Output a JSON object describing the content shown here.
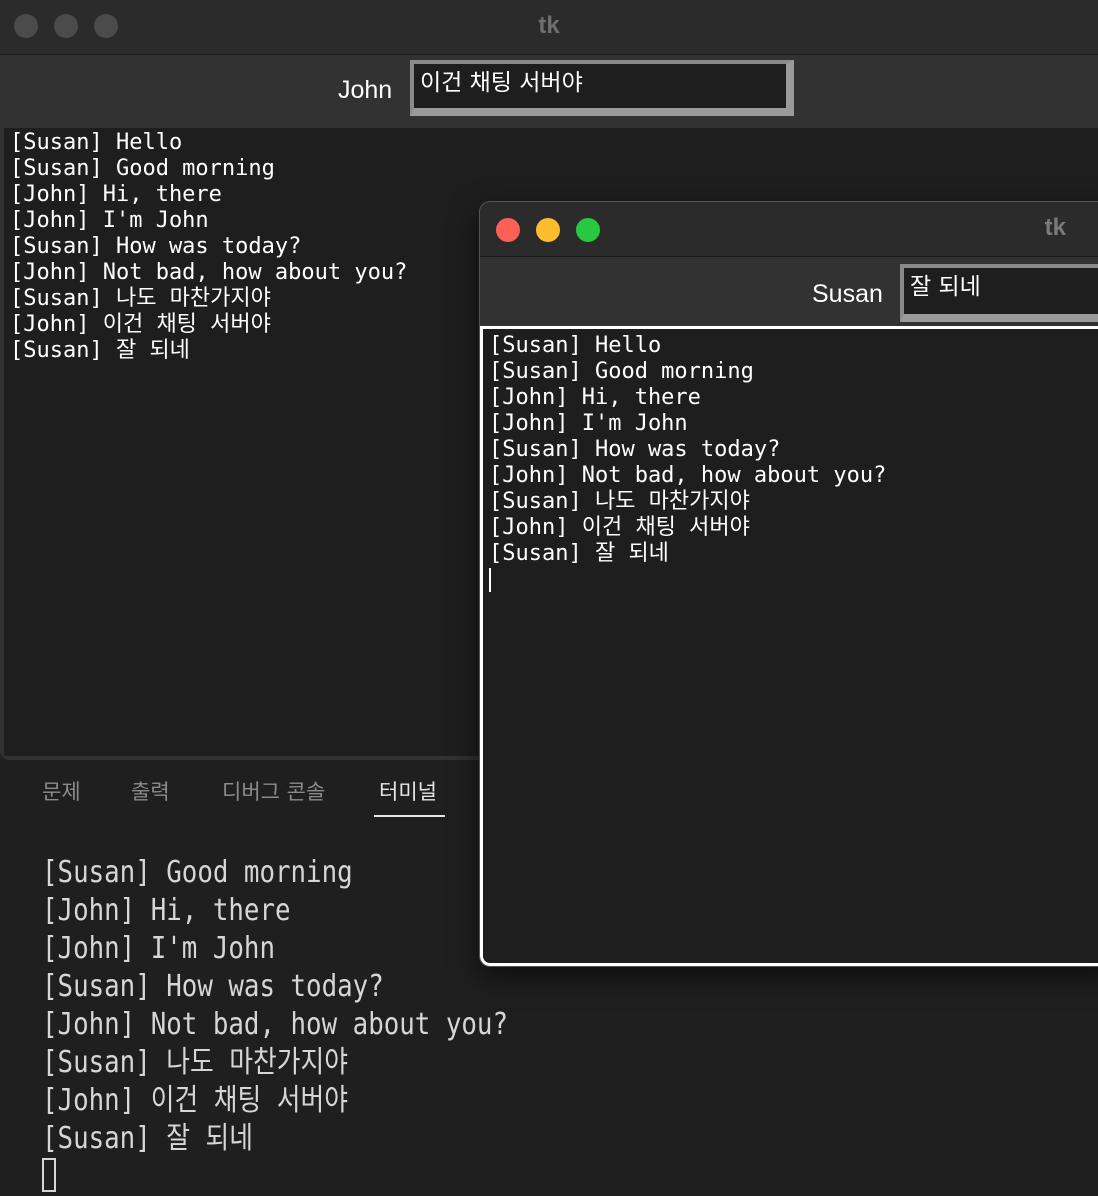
{
  "window_john": {
    "title": "tk",
    "user_label": "John",
    "message_input_value": "이건 채팅 서버야",
    "chat_lines": [
      "[Susan] Hello",
      "[Susan] Good morning",
      "[John] Hi, there",
      "[John] I'm John",
      "[Susan] How was today?",
      "[John] Not bad, how about you?",
      "[Susan] 나도 마찬가지야",
      "[John] 이건 채팅 서버야",
      "[Susan] 잘 되네"
    ]
  },
  "window_susan": {
    "title": "tk",
    "user_label": "Susan",
    "message_input_value": "잘 되네",
    "chat_lines": [
      "[Susan] Hello",
      "[Susan] Good morning",
      "[John] Hi, there",
      "[John] I'm John",
      "[Susan] How was today?",
      "[John] Not bad, how about you?",
      "[Susan] 나도 마찬가지야",
      "[John] 이건 채팅 서버야",
      "[Susan] 잘 되네"
    ]
  },
  "panel": {
    "tabs": [
      {
        "label": "문제"
      },
      {
        "label": "출력"
      },
      {
        "label": "디버그 콘솔"
      },
      {
        "label": "터미널"
      }
    ],
    "active_tab": "터미널",
    "terminal_lines": [
      "[Susan] Good morning",
      "[John] Hi, there",
      "[John] I'm John",
      "[Susan] How was today?",
      "[John] Not bad, how about you?",
      "[Susan] 나도 마찬가지야",
      "[John] 이건 채팅 서버야",
      "[Susan] 잘 되네"
    ]
  }
}
